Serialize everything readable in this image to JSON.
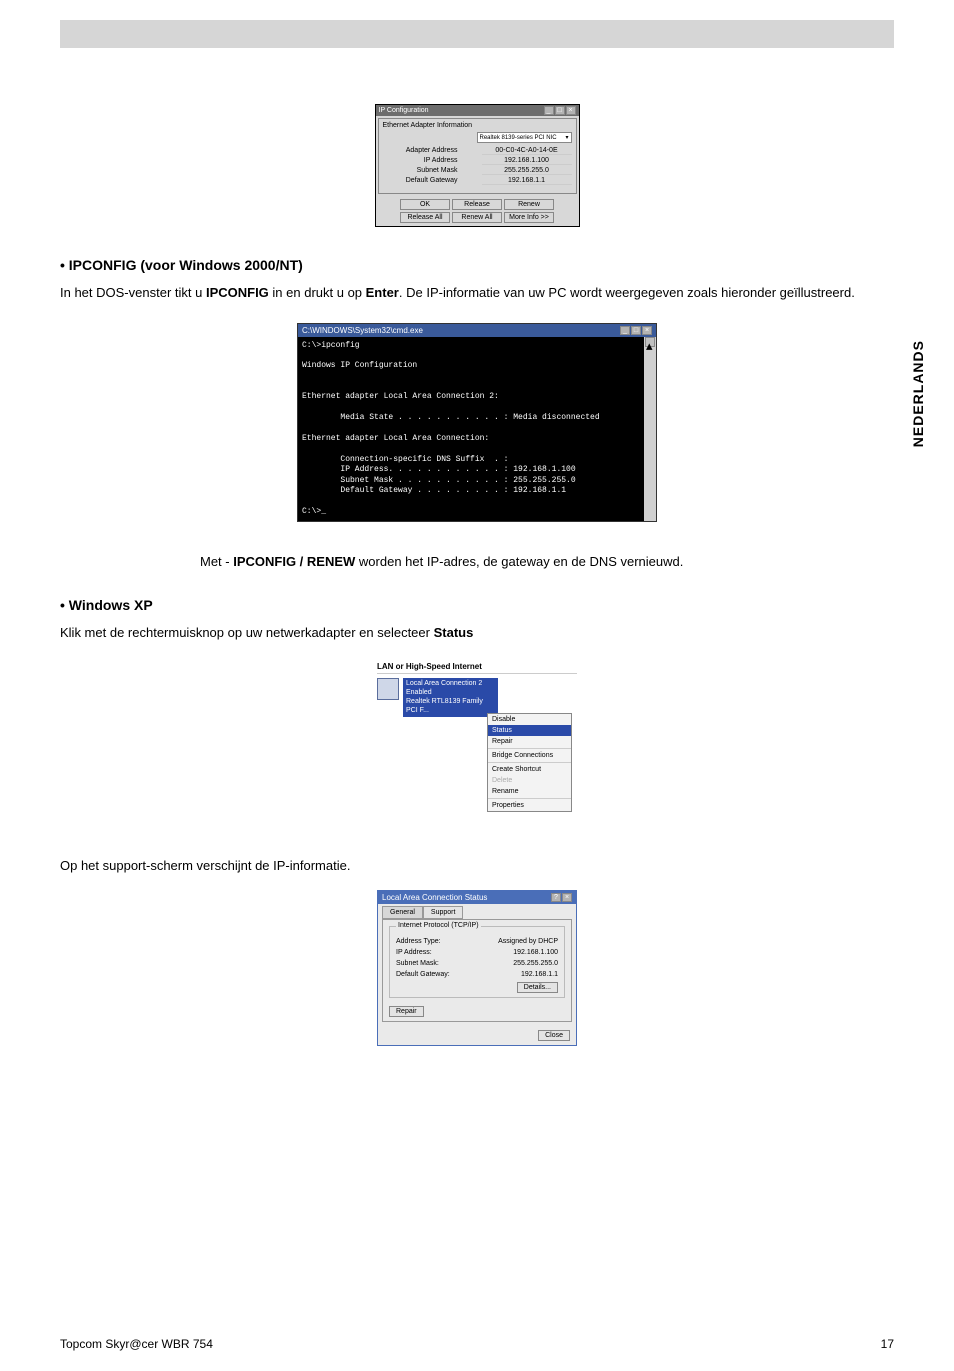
{
  "sideTab": "NEDERLANDS",
  "ipcfgDialog": {
    "title": "IP Configuration",
    "groupLabel": "Ethernet Adapter Information",
    "adapter": "Realtek 8139-series PCI NIC",
    "rows": {
      "adapterAddrLbl": "Adapter Address",
      "adapterAddr": "00-C0-4C-A0-14-0E",
      "ipAddrLbl": "IP Address",
      "ipAddr": "192.168.1.100",
      "subnetLbl": "Subnet Mask",
      "subnet": "255.255.255.0",
      "gatewayLbl": "Default Gateway",
      "gateway": "192.168.1.1"
    },
    "buttons": {
      "ok": "OK",
      "release": "Release",
      "renew": "Renew",
      "releaseAll": "Release All",
      "renewAll": "Renew All",
      "moreInfo": "More Info >>"
    }
  },
  "section1": {
    "heading": "• IPCONFIG (voor Windows 2000/NT)",
    "text_a": "In het DOS-venster tikt u ",
    "text_b": "IPCONFIG",
    "text_c": " in en drukt u op ",
    "text_d": "Enter",
    "text_e": ". De IP-informatie van uw PC wordt weergegeven zoals hieronder geïllustreerd."
  },
  "cmdWindow": {
    "title": "C:\\WINDOWS\\System32\\cmd.exe",
    "body": "C:\\>ipconfig\n\nWindows IP Configuration\n\n\nEthernet adapter Local Area Connection 2:\n\n        Media State . . . . . . . . . . . : Media disconnected\n\nEthernet adapter Local Area Connection:\n\n        Connection-specific DNS Suffix  . :\n        IP Address. . . . . . . . . . . . : 192.168.1.100\n        Subnet Mask . . . . . . . . . . . : 255.255.255.0\n        Default Gateway . . . . . . . . . : 192.168.1.1\n\nC:\\>_"
  },
  "note": {
    "a": "Met - ",
    "b": "IPCONFIG / RENEW",
    "c": " worden het IP-adres, de gateway en de DNS vernieuwd."
  },
  "section2": {
    "heading": "• Windows XP",
    "text_a": "Klik met de rechtermuisknop op uw netwerkadapter en selecteer ",
    "text_b": "Status"
  },
  "netConn": {
    "header": "LAN or High-Speed Internet",
    "itemLine1": "Local Area Connection 2",
    "itemLine2": "Enabled",
    "itemLine3": "Realtek RTL8139 Family PCI F..."
  },
  "ctxMenu": {
    "disable": "Disable",
    "status": "Status",
    "repair": "Repair",
    "bridge": "Bridge Connections",
    "shortcut": "Create Shortcut",
    "delete": "Delete",
    "rename": "Rename",
    "properties": "Properties"
  },
  "section3": {
    "text": "Op het support-scherm verschijnt de IP-informatie."
  },
  "statusDialog": {
    "title": "Local Area Connection Status",
    "tabGeneral": "General",
    "tabSupport": "Support",
    "groupLabel": "Internet Protocol (TCP/IP)",
    "rows": {
      "addrTypeLbl": "Address Type:",
      "addrType": "Assigned by DHCP",
      "ipLbl": "IP Address:",
      "ip": "192.168.1.100",
      "subnetLbl": "Subnet Mask:",
      "subnet": "255.255.255.0",
      "gwLbl": "Default Gateway:",
      "gw": "192.168.1.1"
    },
    "detailsBtn": "Details...",
    "repairBtn": "Repair",
    "closeBtn": "Close"
  },
  "footer": {
    "left": "Topcom Skyr@cer WBR 754",
    "right": "17"
  }
}
